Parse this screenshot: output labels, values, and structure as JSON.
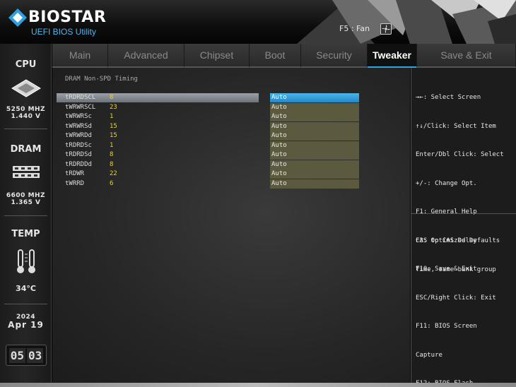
{
  "header": {
    "brand": "BIOSTAR",
    "subtitle": "UEFI BIOS Utility",
    "fan_label": "F5 : Fan"
  },
  "sidebar": {
    "cpu_label": "CPU",
    "cpu_freq": "5250 MHZ",
    "cpu_volt": "1.440 V",
    "dram_label": "DRAM",
    "dram_freq": "6600 MHZ",
    "dram_volt": "1.365 V",
    "temp_label": "TEMP",
    "temp_value": "34°C",
    "year": "2024",
    "date": "Apr 19",
    "time_h": "05",
    "time_m": "03"
  },
  "tabs": [
    {
      "label": "Main"
    },
    {
      "label": "Advanced"
    },
    {
      "label": "Chipset"
    },
    {
      "label": "Boot"
    },
    {
      "label": "Security"
    },
    {
      "label": "Tweaker"
    },
    {
      "label": "Save & Exit"
    }
  ],
  "section_title": "DRAM Non-SPD Timing",
  "rows": [
    {
      "name": "tRDRDSCL",
      "value": "8",
      "option": "Auto"
    },
    {
      "name": "tWRWRSCL",
      "value": "23",
      "option": "Auto"
    },
    {
      "name": "tWRWRSc",
      "value": "1",
      "option": "Auto"
    },
    {
      "name": "tWRWRSd",
      "value": "15",
      "option": "Auto"
    },
    {
      "name": "tWRWRDd",
      "value": "15",
      "option": "Auto"
    },
    {
      "name": "tRDRDSc",
      "value": "1",
      "option": "Auto"
    },
    {
      "name": "tRDRDSd",
      "value": "8",
      "option": "Auto"
    },
    {
      "name": "tRDRDDd",
      "value": "8",
      "option": "Auto"
    },
    {
      "name": "tRDWR",
      "value": "22",
      "option": "Auto"
    },
    {
      "name": "tWRRD",
      "value": "6",
      "option": "Auto"
    }
  ],
  "help_keys": [
    "→←: Select Screen",
    "↑↓/Click: Select Item",
    "Enter/Dbl Click: Select",
    "+/-: Change Opt.",
    "F1: General Help",
    "F3: Optimized Defaults",
    "F10: Save & Exit",
    "ESC/Right Click: Exit",
    "F11: BIOS Screen",
    "Capture",
    "F12: BIOS Flash"
  ],
  "help_desc": [
    "CAS to CAS Delay",
    "Time, same bank group"
  ],
  "colors": {
    "accent": "#29a8e0",
    "value_yellow": "#e8d23c",
    "option_bg": "#5c5a3e"
  }
}
